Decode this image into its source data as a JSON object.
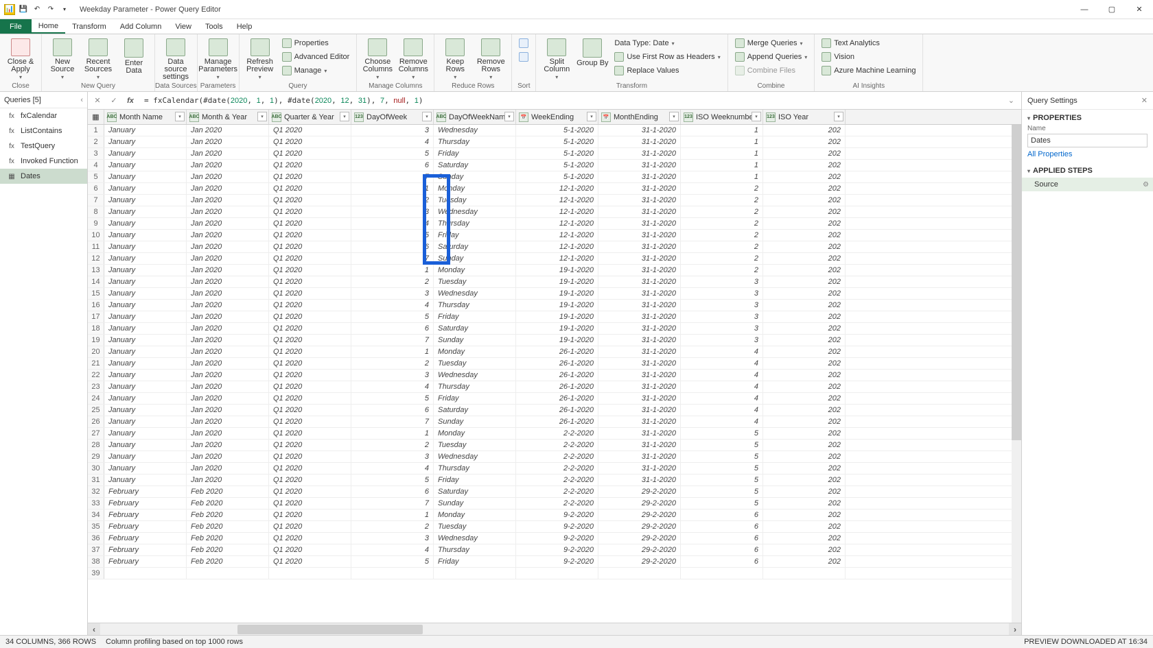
{
  "title": "Weekday Parameter - Power Query Editor",
  "menus": {
    "file": "File",
    "home": "Home",
    "transform": "Transform",
    "add": "Add Column",
    "view": "View",
    "tools": "Tools",
    "help": "Help"
  },
  "ribbon": {
    "close": {
      "btn": "Close &\nApply",
      "grp": "Close"
    },
    "newq": {
      "new": "New\nSource",
      "recent": "Recent\nSources",
      "enter": "Enter\nData",
      "grp": "New Query"
    },
    "ds": {
      "btn": "Data source\nsettings",
      "grp": "Data Sources"
    },
    "param": {
      "btn": "Manage\nParameters",
      "grp": "Parameters"
    },
    "query": {
      "refresh": "Refresh\nPreview",
      "props": "Properties",
      "adv": "Advanced Editor",
      "manage": "Manage",
      "grp": "Query"
    },
    "cols": {
      "choose": "Choose\nColumns",
      "remove": "Remove\nColumns",
      "grp": "Manage Columns"
    },
    "rows": {
      "keep": "Keep\nRows",
      "remove": "Remove\nRows",
      "grp": "Reduce Rows"
    },
    "sort": {
      "grp": "Sort"
    },
    "trans": {
      "split": "Split\nColumn",
      "group": "Group\nBy",
      "dt": "Data Type: Date",
      "first": "Use First Row as Headers",
      "replace": "Replace Values",
      "grp": "Transform"
    },
    "combine": {
      "merge": "Merge Queries",
      "append": "Append Queries",
      "files": "Combine Files",
      "grp": "Combine"
    },
    "ai": {
      "text": "Text Analytics",
      "vision": "Vision",
      "ml": "Azure Machine Learning",
      "grp": "AI Insights"
    }
  },
  "queries": {
    "title": "Queries [5]",
    "items": [
      {
        "icon": "fx",
        "label": "fxCalendar"
      },
      {
        "icon": "fx",
        "label": "ListContains"
      },
      {
        "icon": "fx",
        "label": "TestQuery"
      },
      {
        "icon": "fx",
        "label": "Invoked Function"
      },
      {
        "icon": "▦",
        "label": "Dates",
        "sel": true
      }
    ]
  },
  "formula": "= fxCalendar(#date(2020, 1, 1), #date(2020, 12, 31), 7, null, 1)",
  "columns": [
    {
      "k": "mn",
      "label": "Month Name",
      "typ": "ABC",
      "cls": "c-mn"
    },
    {
      "k": "my",
      "label": "Month & Year",
      "typ": "ABC",
      "cls": "c-my"
    },
    {
      "k": "qy",
      "label": "Quarter & Year",
      "typ": "ABC",
      "cls": "c-qy"
    },
    {
      "k": "dw",
      "label": "DayOfWeek",
      "typ": "123",
      "cls": "c-dw",
      "num": true
    },
    {
      "k": "dn",
      "label": "DayOfWeekName",
      "typ": "ABC",
      "cls": "c-dn"
    },
    {
      "k": "we",
      "label": "WeekEnding",
      "typ": "📅",
      "cls": "c-we",
      "num": true
    },
    {
      "k": "me",
      "label": "MonthEnding",
      "typ": "📅",
      "cls": "c-me",
      "num": true
    },
    {
      "k": "iw",
      "label": "ISO Weeknumber",
      "typ": "123",
      "cls": "c-iw",
      "num": true
    },
    {
      "k": "iy",
      "label": "ISO Year",
      "typ": "123",
      "cls": "c-iy",
      "num": true
    }
  ],
  "rows": [
    {
      "n": 1,
      "mn": "January",
      "my": "Jan 2020",
      "qy": "Q1 2020",
      "dw": "3",
      "dn": "Wednesday",
      "we": "5-1-2020",
      "me": "31-1-2020",
      "iw": "1",
      "iy": "202"
    },
    {
      "n": 2,
      "mn": "January",
      "my": "Jan 2020",
      "qy": "Q1 2020",
      "dw": "4",
      "dn": "Thursday",
      "we": "5-1-2020",
      "me": "31-1-2020",
      "iw": "1",
      "iy": "202"
    },
    {
      "n": 3,
      "mn": "January",
      "my": "Jan 2020",
      "qy": "Q1 2020",
      "dw": "5",
      "dn": "Friday",
      "we": "5-1-2020",
      "me": "31-1-2020",
      "iw": "1",
      "iy": "202"
    },
    {
      "n": 4,
      "mn": "January",
      "my": "Jan 2020",
      "qy": "Q1 2020",
      "dw": "6",
      "dn": "Saturday",
      "we": "5-1-2020",
      "me": "31-1-2020",
      "iw": "1",
      "iy": "202"
    },
    {
      "n": 5,
      "mn": "January",
      "my": "Jan 2020",
      "qy": "Q1 2020",
      "dw": "7",
      "dn": "Sunday",
      "we": "5-1-2020",
      "me": "31-1-2020",
      "iw": "1",
      "iy": "202"
    },
    {
      "n": 6,
      "mn": "January",
      "my": "Jan 2020",
      "qy": "Q1 2020",
      "dw": "1",
      "dn": "Monday",
      "we": "12-1-2020",
      "me": "31-1-2020",
      "iw": "2",
      "iy": "202"
    },
    {
      "n": 7,
      "mn": "January",
      "my": "Jan 2020",
      "qy": "Q1 2020",
      "dw": "2",
      "dn": "Tuesday",
      "we": "12-1-2020",
      "me": "31-1-2020",
      "iw": "2",
      "iy": "202"
    },
    {
      "n": 8,
      "mn": "January",
      "my": "Jan 2020",
      "qy": "Q1 2020",
      "dw": "3",
      "dn": "Wednesday",
      "we": "12-1-2020",
      "me": "31-1-2020",
      "iw": "2",
      "iy": "202"
    },
    {
      "n": 9,
      "mn": "January",
      "my": "Jan 2020",
      "qy": "Q1 2020",
      "dw": "4",
      "dn": "Thursday",
      "we": "12-1-2020",
      "me": "31-1-2020",
      "iw": "2",
      "iy": "202"
    },
    {
      "n": 10,
      "mn": "January",
      "my": "Jan 2020",
      "qy": "Q1 2020",
      "dw": "5",
      "dn": "Friday",
      "we": "12-1-2020",
      "me": "31-1-2020",
      "iw": "2",
      "iy": "202"
    },
    {
      "n": 11,
      "mn": "January",
      "my": "Jan 2020",
      "qy": "Q1 2020",
      "dw": "6",
      "dn": "Saturday",
      "we": "12-1-2020",
      "me": "31-1-2020",
      "iw": "2",
      "iy": "202"
    },
    {
      "n": 12,
      "mn": "January",
      "my": "Jan 2020",
      "qy": "Q1 2020",
      "dw": "7",
      "dn": "Sunday",
      "we": "12-1-2020",
      "me": "31-1-2020",
      "iw": "2",
      "iy": "202"
    },
    {
      "n": 13,
      "mn": "January",
      "my": "Jan 2020",
      "qy": "Q1 2020",
      "dw": "1",
      "dn": "Monday",
      "we": "19-1-2020",
      "me": "31-1-2020",
      "iw": "2",
      "iy": "202"
    },
    {
      "n": 14,
      "mn": "January",
      "my": "Jan 2020",
      "qy": "Q1 2020",
      "dw": "2",
      "dn": "Tuesday",
      "we": "19-1-2020",
      "me": "31-1-2020",
      "iw": "3",
      "iy": "202"
    },
    {
      "n": 15,
      "mn": "January",
      "my": "Jan 2020",
      "qy": "Q1 2020",
      "dw": "3",
      "dn": "Wednesday",
      "we": "19-1-2020",
      "me": "31-1-2020",
      "iw": "3",
      "iy": "202"
    },
    {
      "n": 16,
      "mn": "January",
      "my": "Jan 2020",
      "qy": "Q1 2020",
      "dw": "4",
      "dn": "Thursday",
      "we": "19-1-2020",
      "me": "31-1-2020",
      "iw": "3",
      "iy": "202"
    },
    {
      "n": 17,
      "mn": "January",
      "my": "Jan 2020",
      "qy": "Q1 2020",
      "dw": "5",
      "dn": "Friday",
      "we": "19-1-2020",
      "me": "31-1-2020",
      "iw": "3",
      "iy": "202"
    },
    {
      "n": 18,
      "mn": "January",
      "my": "Jan 2020",
      "qy": "Q1 2020",
      "dw": "6",
      "dn": "Saturday",
      "we": "19-1-2020",
      "me": "31-1-2020",
      "iw": "3",
      "iy": "202"
    },
    {
      "n": 19,
      "mn": "January",
      "my": "Jan 2020",
      "qy": "Q1 2020",
      "dw": "7",
      "dn": "Sunday",
      "we": "19-1-2020",
      "me": "31-1-2020",
      "iw": "3",
      "iy": "202"
    },
    {
      "n": 20,
      "mn": "January",
      "my": "Jan 2020",
      "qy": "Q1 2020",
      "dw": "1",
      "dn": "Monday",
      "we": "26-1-2020",
      "me": "31-1-2020",
      "iw": "4",
      "iy": "202"
    },
    {
      "n": 21,
      "mn": "January",
      "my": "Jan 2020",
      "qy": "Q1 2020",
      "dw": "2",
      "dn": "Tuesday",
      "we": "26-1-2020",
      "me": "31-1-2020",
      "iw": "4",
      "iy": "202"
    },
    {
      "n": 22,
      "mn": "January",
      "my": "Jan 2020",
      "qy": "Q1 2020",
      "dw": "3",
      "dn": "Wednesday",
      "we": "26-1-2020",
      "me": "31-1-2020",
      "iw": "4",
      "iy": "202"
    },
    {
      "n": 23,
      "mn": "January",
      "my": "Jan 2020",
      "qy": "Q1 2020",
      "dw": "4",
      "dn": "Thursday",
      "we": "26-1-2020",
      "me": "31-1-2020",
      "iw": "4",
      "iy": "202"
    },
    {
      "n": 24,
      "mn": "January",
      "my": "Jan 2020",
      "qy": "Q1 2020",
      "dw": "5",
      "dn": "Friday",
      "we": "26-1-2020",
      "me": "31-1-2020",
      "iw": "4",
      "iy": "202"
    },
    {
      "n": 25,
      "mn": "January",
      "my": "Jan 2020",
      "qy": "Q1 2020",
      "dw": "6",
      "dn": "Saturday",
      "we": "26-1-2020",
      "me": "31-1-2020",
      "iw": "4",
      "iy": "202"
    },
    {
      "n": 26,
      "mn": "January",
      "my": "Jan 2020",
      "qy": "Q1 2020",
      "dw": "7",
      "dn": "Sunday",
      "we": "26-1-2020",
      "me": "31-1-2020",
      "iw": "4",
      "iy": "202"
    },
    {
      "n": 27,
      "mn": "January",
      "my": "Jan 2020",
      "qy": "Q1 2020",
      "dw": "1",
      "dn": "Monday",
      "we": "2-2-2020",
      "me": "31-1-2020",
      "iw": "5",
      "iy": "202"
    },
    {
      "n": 28,
      "mn": "January",
      "my": "Jan 2020",
      "qy": "Q1 2020",
      "dw": "2",
      "dn": "Tuesday",
      "we": "2-2-2020",
      "me": "31-1-2020",
      "iw": "5",
      "iy": "202"
    },
    {
      "n": 29,
      "mn": "January",
      "my": "Jan 2020",
      "qy": "Q1 2020",
      "dw": "3",
      "dn": "Wednesday",
      "we": "2-2-2020",
      "me": "31-1-2020",
      "iw": "5",
      "iy": "202"
    },
    {
      "n": 30,
      "mn": "January",
      "my": "Jan 2020",
      "qy": "Q1 2020",
      "dw": "4",
      "dn": "Thursday",
      "we": "2-2-2020",
      "me": "31-1-2020",
      "iw": "5",
      "iy": "202"
    },
    {
      "n": 31,
      "mn": "January",
      "my": "Jan 2020",
      "qy": "Q1 2020",
      "dw": "5",
      "dn": "Friday",
      "we": "2-2-2020",
      "me": "31-1-2020",
      "iw": "5",
      "iy": "202"
    },
    {
      "n": 32,
      "mn": "February",
      "my": "Feb 2020",
      "qy": "Q1 2020",
      "dw": "6",
      "dn": "Saturday",
      "we": "2-2-2020",
      "me": "29-2-2020",
      "iw": "5",
      "iy": "202"
    },
    {
      "n": 33,
      "mn": "February",
      "my": "Feb 2020",
      "qy": "Q1 2020",
      "dw": "7",
      "dn": "Sunday",
      "we": "2-2-2020",
      "me": "29-2-2020",
      "iw": "5",
      "iy": "202"
    },
    {
      "n": 34,
      "mn": "February",
      "my": "Feb 2020",
      "qy": "Q1 2020",
      "dw": "1",
      "dn": "Monday",
      "we": "9-2-2020",
      "me": "29-2-2020",
      "iw": "6",
      "iy": "202"
    },
    {
      "n": 35,
      "mn": "February",
      "my": "Feb 2020",
      "qy": "Q1 2020",
      "dw": "2",
      "dn": "Tuesday",
      "we": "9-2-2020",
      "me": "29-2-2020",
      "iw": "6",
      "iy": "202"
    },
    {
      "n": 36,
      "mn": "February",
      "my": "Feb 2020",
      "qy": "Q1 2020",
      "dw": "3",
      "dn": "Wednesday",
      "we": "9-2-2020",
      "me": "29-2-2020",
      "iw": "6",
      "iy": "202"
    },
    {
      "n": 37,
      "mn": "February",
      "my": "Feb 2020",
      "qy": "Q1 2020",
      "dw": "4",
      "dn": "Thursday",
      "we": "9-2-2020",
      "me": "29-2-2020",
      "iw": "6",
      "iy": "202"
    },
    {
      "n": 38,
      "mn": "February",
      "my": "Feb 2020",
      "qy": "Q1 2020",
      "dw": "5",
      "dn": "Friday",
      "we": "9-2-2020",
      "me": "29-2-2020",
      "iw": "6",
      "iy": "202"
    },
    {
      "n": 39,
      "mn": "",
      "my": "",
      "qy": "",
      "dw": "",
      "dn": "",
      "we": "",
      "me": "",
      "iw": "",
      "iy": ""
    }
  ],
  "settings": {
    "title": "Query Settings",
    "props": "PROPERTIES",
    "name_lbl": "Name",
    "name_val": "Dates",
    "allprops": "All Properties",
    "steps": "APPLIED STEPS",
    "step0": "Source"
  },
  "status": {
    "left": "34 COLUMNS, 366 ROWS",
    "mid": "Column profiling based on top 1000 rows",
    "right": "PREVIEW DOWNLOADED AT 16:34"
  }
}
